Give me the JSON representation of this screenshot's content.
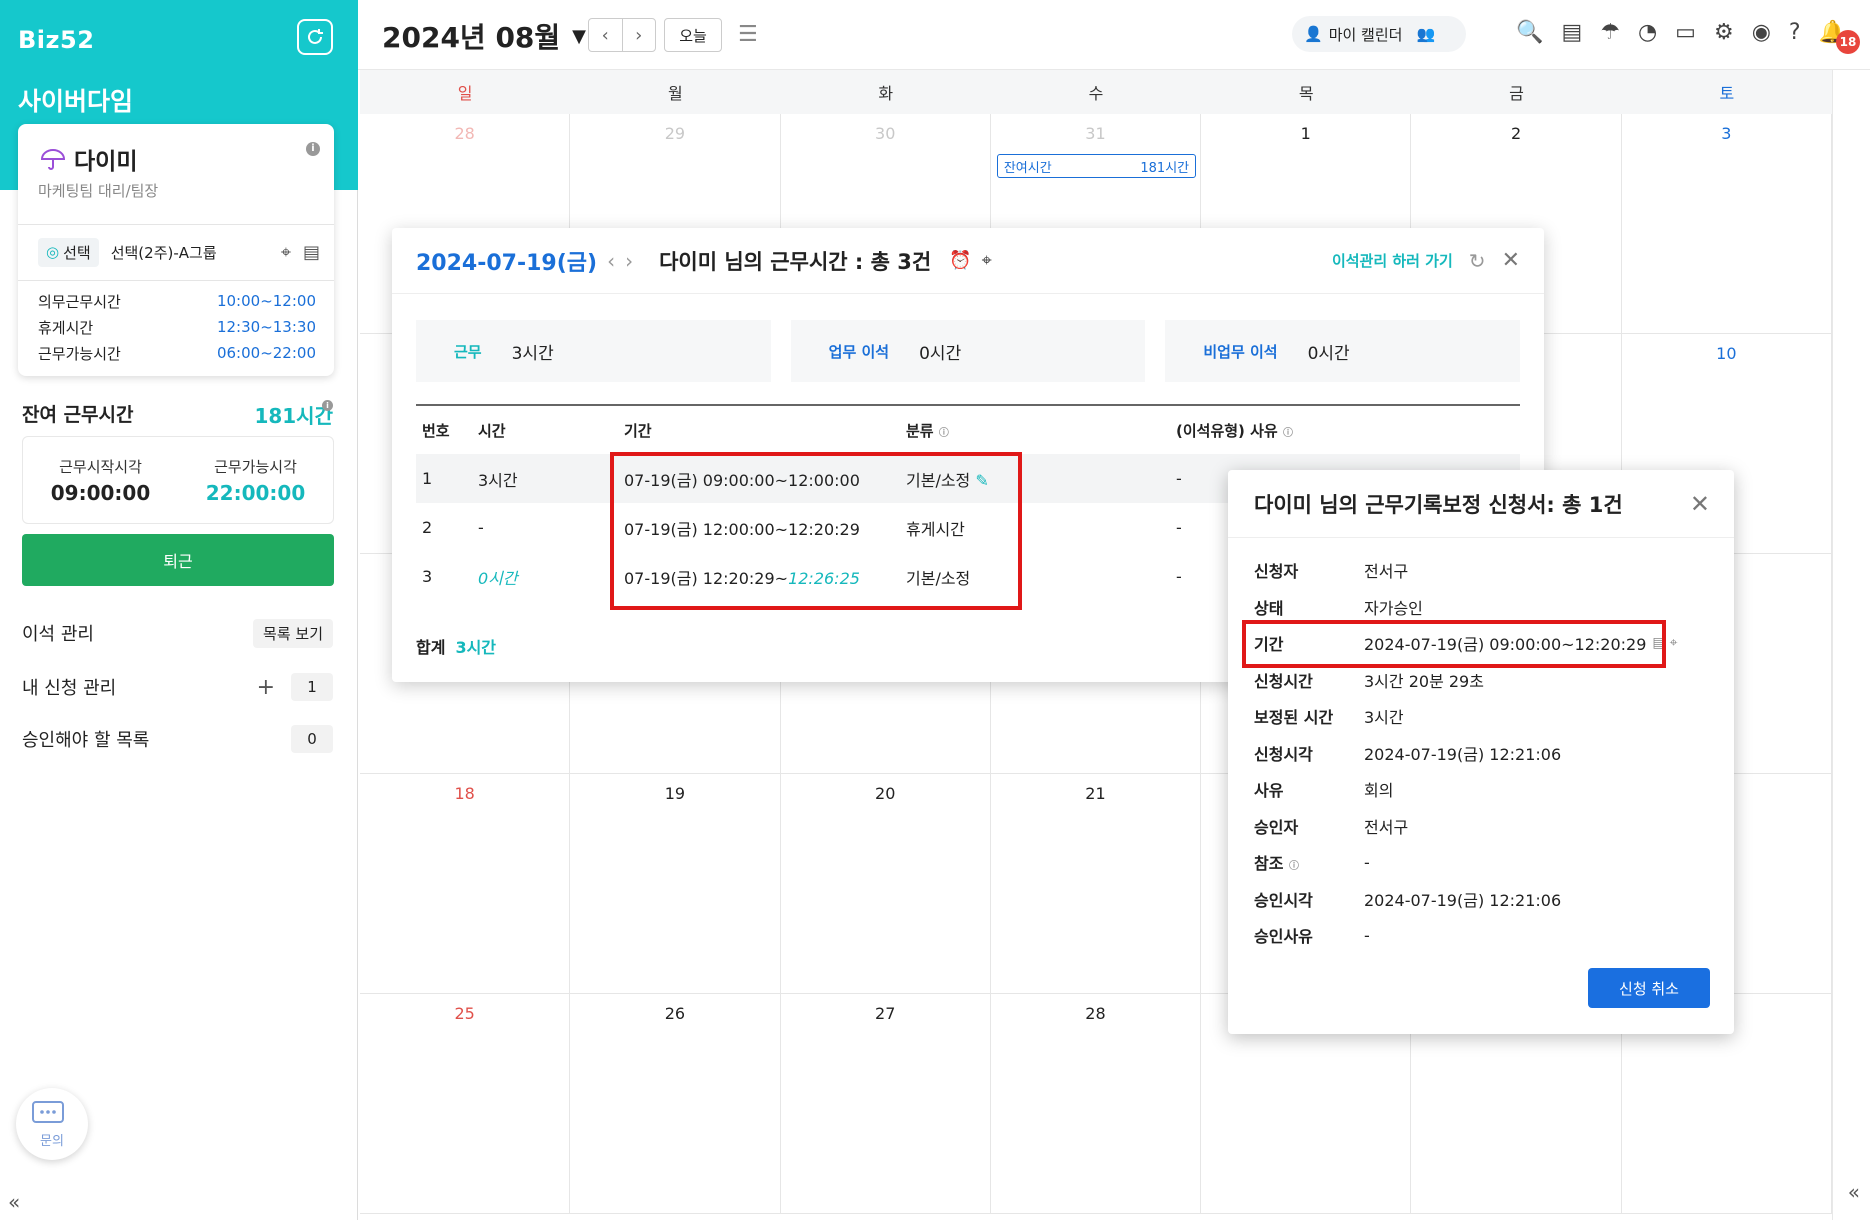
{
  "sidebar": {
    "logo": "Biz52",
    "company": "사이버다임",
    "profile": {
      "name": "다이미",
      "dept": "마케팅팀 대리/팀장"
    },
    "group": {
      "tag": "선택",
      "name": "선택(2주)-A그룹"
    },
    "times": [
      {
        "label": "의무근무시간",
        "value": "10:00~12:00"
      },
      {
        "label": "휴게시간",
        "value": "12:30~13:30"
      },
      {
        "label": "근무가능시간",
        "value": "06:00~22:00"
      }
    ],
    "remain_title": "잔여 근무시간",
    "remain_value": "181시간",
    "start_label": "근무시작시각",
    "start_value": "09:00:00",
    "avail_label": "근무가능시각",
    "avail_value": "22:00:00",
    "leave_button": "퇴근",
    "menu": [
      {
        "label": "이석 관리",
        "action": "목록 보기"
      },
      {
        "label": "내 신청 관리",
        "count": "1"
      },
      {
        "label": "승인해야 할 목록",
        "count": "0"
      }
    ],
    "chat_label": "문의"
  },
  "header": {
    "month": "2024년 08월",
    "today": "오늘",
    "mycal": "마이 캘린더",
    "badge": "18"
  },
  "calendar": {
    "dows": [
      "일",
      "월",
      "화",
      "수",
      "목",
      "금",
      "토"
    ],
    "weeks": [
      [
        "28",
        "29",
        "30",
        "31",
        "1",
        "2",
        "3"
      ],
      [
        "",
        "",
        "",
        "",
        "",
        "",
        "10"
      ],
      [
        "",
        "",
        "",
        "",
        "",
        "",
        ""
      ],
      [
        "18",
        "19",
        "20",
        "21",
        "",
        "",
        ""
      ],
      [
        "25",
        "26",
        "27",
        "28",
        "",
        "",
        ""
      ]
    ],
    "chip_label": "잔여시간",
    "chip_value": "181시간"
  },
  "modal1": {
    "date": "2024-07-19(금)",
    "title": "다이미 님의 근무시간 : 총 3건",
    "link": "이석관리 하러 가기",
    "summary": [
      {
        "key": "근무",
        "value": "3시간"
      },
      {
        "key": "업무 이석",
        "value": "0시간"
      },
      {
        "key": "비업무 이석",
        "value": "0시간"
      }
    ],
    "columns": [
      "번호",
      "시간",
      "기간",
      "분류",
      "(이석유형) 사유"
    ],
    "rows": [
      {
        "no": "1",
        "time": "3시간",
        "period": "07-19(금) 09:00:00~12:00:00",
        "type": "기본/소정",
        "reason": "-"
      },
      {
        "no": "2",
        "time": "-",
        "period": "07-19(금) 12:00:00~12:20:29",
        "type": "휴게시간",
        "reason": "-"
      },
      {
        "no": "3",
        "time": "0시간",
        "period_a": "07-19(금) 12:20:29~",
        "period_b": "12:26:25",
        "type": "기본/소정",
        "reason": "-"
      }
    ],
    "total_label": "합계",
    "total_value": "3시간"
  },
  "modal2": {
    "title": "다이미 님의 근무기록보정 신청서: 총 1건",
    "fields": [
      {
        "k": "신청자",
        "v": "전서구"
      },
      {
        "k": "상태",
        "v": "자가승인"
      },
      {
        "k": "기간",
        "v": "2024-07-19(금) 09:00:00~12:20:29"
      },
      {
        "k": "신청시간",
        "v": "3시간 20분 29초"
      },
      {
        "k": "보정된 시간",
        "v": "3시간"
      },
      {
        "k": "신청시각",
        "v": "2024-07-19(금) 12:21:06"
      },
      {
        "k": "사유",
        "v": "회의"
      },
      {
        "k": "승인자",
        "v": "전서구"
      },
      {
        "k": "참조",
        "v": "-"
      },
      {
        "k": "승인시각",
        "v": "2024-07-19(금) 12:21:06"
      },
      {
        "k": "승인사유",
        "v": "-"
      }
    ],
    "cancel": "신청 취소"
  }
}
